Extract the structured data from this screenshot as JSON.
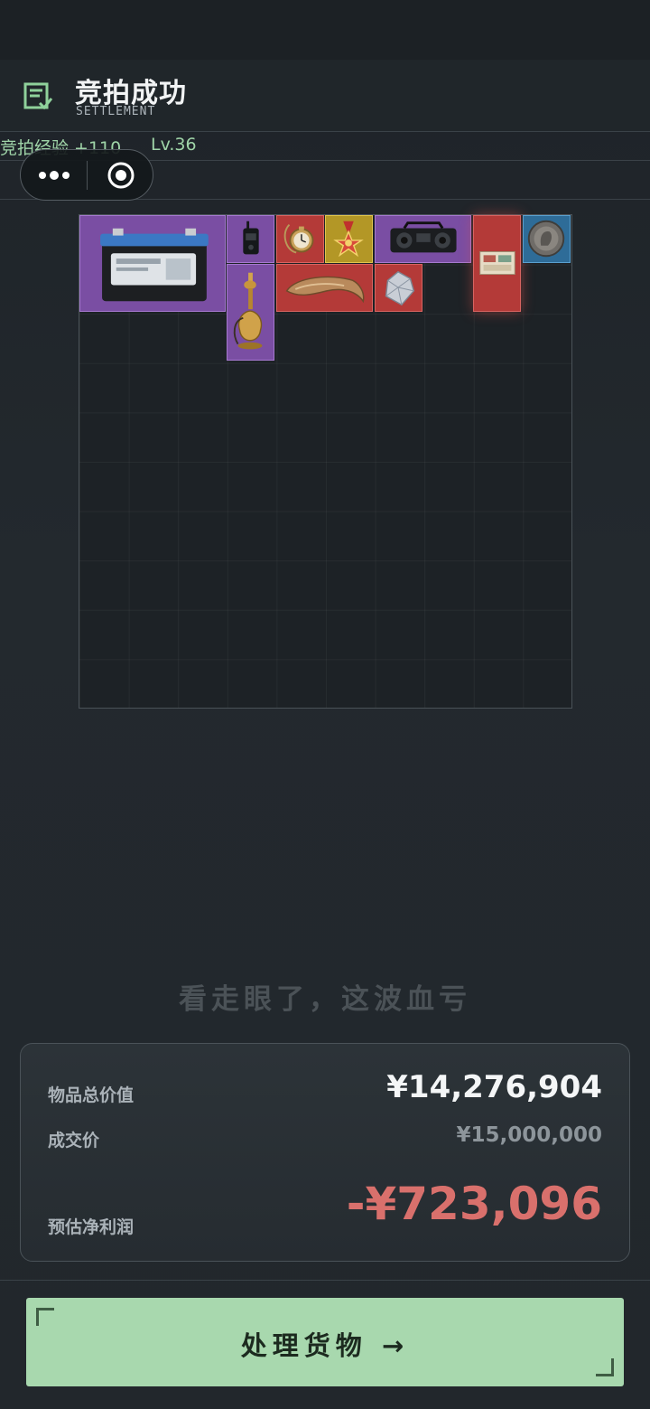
{
  "header": {
    "title": "竞拍成功",
    "subtitle": "SETTLEMENT",
    "icon": "document-edit-icon"
  },
  "progress": {
    "exp_text": "竞拍经验 +110",
    "level_text": "Lv.36"
  },
  "mini_program": {
    "more_icon": "more-dots-icon",
    "close_icon": "target-close-icon"
  },
  "inventory": {
    "columns": 10,
    "rows": 10,
    "items": [
      {
        "name": "car-battery",
        "rarity": "purple",
        "icon": "battery-icon"
      },
      {
        "name": "walkie-talkie",
        "rarity": "purple",
        "icon": "radio-icon"
      },
      {
        "name": "pocket-watch",
        "rarity": "red",
        "icon": "pocket-watch-icon"
      },
      {
        "name": "medal",
        "rarity": "gold",
        "icon": "medal-icon"
      },
      {
        "name": "boombox",
        "rarity": "purple",
        "icon": "boombox-icon"
      },
      {
        "name": "banknotes",
        "rarity": "red",
        "icon": "banknote-icon"
      },
      {
        "name": "ancient-coin",
        "rarity": "blue",
        "icon": "coin-icon"
      },
      {
        "name": "hookah",
        "rarity": "purple",
        "icon": "hookah-icon"
      },
      {
        "name": "fossil-claw",
        "rarity": "red",
        "icon": "claw-icon"
      },
      {
        "name": "diamond",
        "rarity": "red",
        "icon": "diamond-icon"
      }
    ],
    "colors": {
      "purple": "#7a4ea3",
      "red": "#b43a38",
      "gold": "#b39726",
      "blue": "#2e6c98"
    }
  },
  "slogan": "看走眼了，这波血亏",
  "summary": {
    "total_value_label": "物品总价值",
    "total_value": "¥14,276,904",
    "deal_price_label": "成交价",
    "deal_price": "¥15,000,000",
    "profit_label": "预估净利润",
    "profit": "-¥723,096",
    "profit_color": "#d9706c"
  },
  "action": {
    "label": "处理货物 →"
  }
}
